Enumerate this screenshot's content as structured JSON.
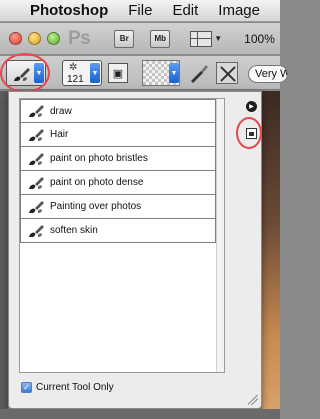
{
  "menubar": {
    "apple_icon": "apple-logo",
    "app_name": "Photoshop",
    "items": [
      "File",
      "Edit",
      "Image"
    ]
  },
  "appbar": {
    "logo": "Ps",
    "bridge_label": "Br",
    "minibridge_label": "Mb",
    "zoom": "100%"
  },
  "options": {
    "brush_size": "121",
    "sample_label": "Very W",
    "tool_preset_icon": "mixer-brush-icon"
  },
  "presets": {
    "items": [
      {
        "label": "draw",
        "icon": "brush-icon"
      },
      {
        "label": "Hair",
        "icon": "brush-icon"
      },
      {
        "label": "paint on photo bristles",
        "icon": "brush-icon"
      },
      {
        "label": "paint on photo dense",
        "icon": "brush-icon"
      },
      {
        "label": "Painting over photos",
        "icon": "brush-icon"
      },
      {
        "label": "soften skin",
        "icon": "brush-icon"
      }
    ],
    "current_tool_only_label": "Current Tool Only",
    "current_tool_only_checked": true
  },
  "colors": {
    "highlight_circle": "#e8474e",
    "checkbox_blue": "#3d7ad6"
  }
}
